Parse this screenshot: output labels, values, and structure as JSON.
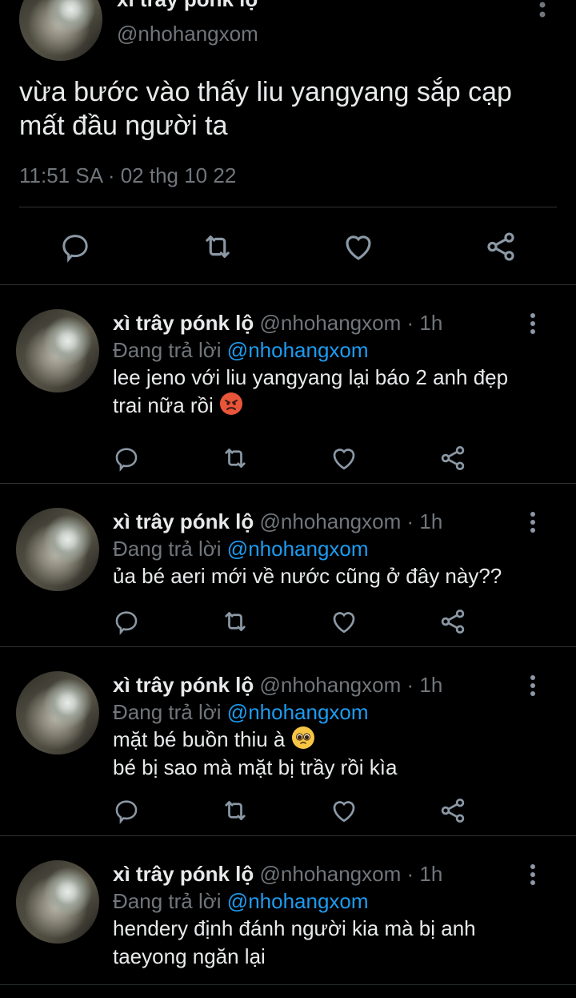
{
  "main_tweet": {
    "name_partial": "xì trây pónk lộ",
    "handle": "@nhohangxom",
    "text": "vừa bước vào thấy liu yangyang sắp cạp mất đầu người ta",
    "timestamp": "11:51 SA · 02 thg 10 22"
  },
  "replies": [
    {
      "name": "xì trây pónk lộ",
      "handle": "@nhohangxom",
      "time": "1h",
      "replying_prefix": "Đang trả lời",
      "replying_to": "@nhohangxom",
      "lines": [
        "lee jeno với liu yangyang lại báo 2 anh đẹp",
        "trai nữa rồi"
      ],
      "emoji": "angry-face"
    },
    {
      "name": "xì trây pónk lộ",
      "handle": "@nhohangxom",
      "time": "1h",
      "replying_prefix": "Đang trả lời",
      "replying_to": "@nhohangxom",
      "lines": [
        "ủa bé aeri mới về nước cũng ở đây này??"
      ]
    },
    {
      "name": "xì trây pónk lộ",
      "handle": "@nhohangxom",
      "time": "1h",
      "replying_prefix": "Đang trả lời",
      "replying_to": "@nhohangxom",
      "lines": [
        "mặt bé buồn thiu à",
        "bé bị sao mà mặt bị trầy rồi kìa"
      ],
      "emoji": "pleading-face"
    },
    {
      "name": "xì trây pónk lộ",
      "handle": "@nhohangxom",
      "time": "1h",
      "replying_prefix": "Đang trả lời",
      "replying_to": "@nhohangxom",
      "lines": [
        "hendery định đánh người kia mà bị anh",
        "taeyong ngăn lại"
      ]
    }
  ],
  "colors": {
    "background": "#000000",
    "text": "#e7e9ea",
    "secondary": "#71767b",
    "link": "#1d9bf0",
    "divider": "#2f3336"
  },
  "icons": [
    "reply-icon",
    "retweet-icon",
    "like-icon",
    "share-icon",
    "more-icon"
  ]
}
